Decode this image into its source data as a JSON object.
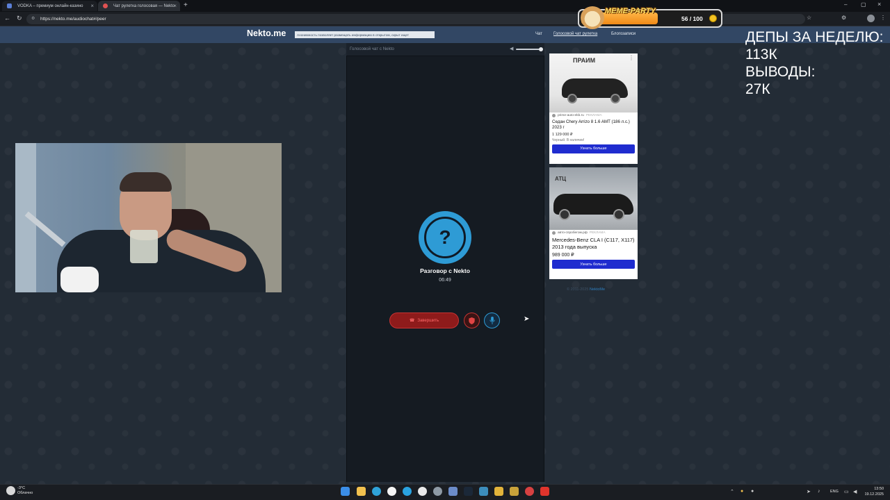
{
  "browser": {
    "tabs": [
      {
        "label": "VODKA – премиум онлайн-казино"
      },
      {
        "label": "Чат рулетка голосовая — Nekto"
      }
    ],
    "url": "https://nekto.me/audiochat#/peer"
  },
  "site": {
    "logo": "Nekto.me",
    "notice": "Анонимность позволяет размещать информацию в открытом, скрыт ищет",
    "nav": [
      "Чат",
      "Голосовой чат рулетка",
      "Блогозаписи"
    ]
  },
  "chat": {
    "header": "Голосовой чат с Nekto",
    "avatar_symbol": "?",
    "talk_title": "Разговор с Nekto",
    "timer": "06:49",
    "end_label": "Завершить",
    "accent": "#2e9bd5",
    "danger": "#c73333"
  },
  "ads": [
    {
      "brand": "ПРАИМ",
      "source": "prime-auto-ekb.ru",
      "tag": "РЕКЛАМА",
      "title": "Седан Chery Arrizo 8 1.6 AMT (186 л.с.) 2023 г",
      "price": "1 129 000 ₽",
      "note": "Черный. В наличии!",
      "button": "Узнать больше"
    },
    {
      "brand": "АТЦ",
      "source": "авто-спробегом.рф",
      "tag": "РЕКЛАМА",
      "title": "Mercedes-Benz CLA I (C117, X117) 2013 года выпуска",
      "price": "989 000 ₽",
      "button": "Узнать больше"
    }
  ],
  "footer": {
    "copyright": "© 2011-2025",
    "link": "NektoMe"
  },
  "overlay": {
    "line1": "ДЕПЫ ЗА НЕДЕЛЮ:",
    "line2": "113К",
    "line3": "ВЫВОДЫ:",
    "line4": "27К"
  },
  "meme_party": {
    "title": "MEME-PARTY",
    "count": "56 / 100",
    "progress": 0.56
  },
  "taskbar": {
    "temperature": "-3°C",
    "weather": "Облачно",
    "lang": "ENG",
    "time": "13:50",
    "date": "19.12.2025"
  }
}
